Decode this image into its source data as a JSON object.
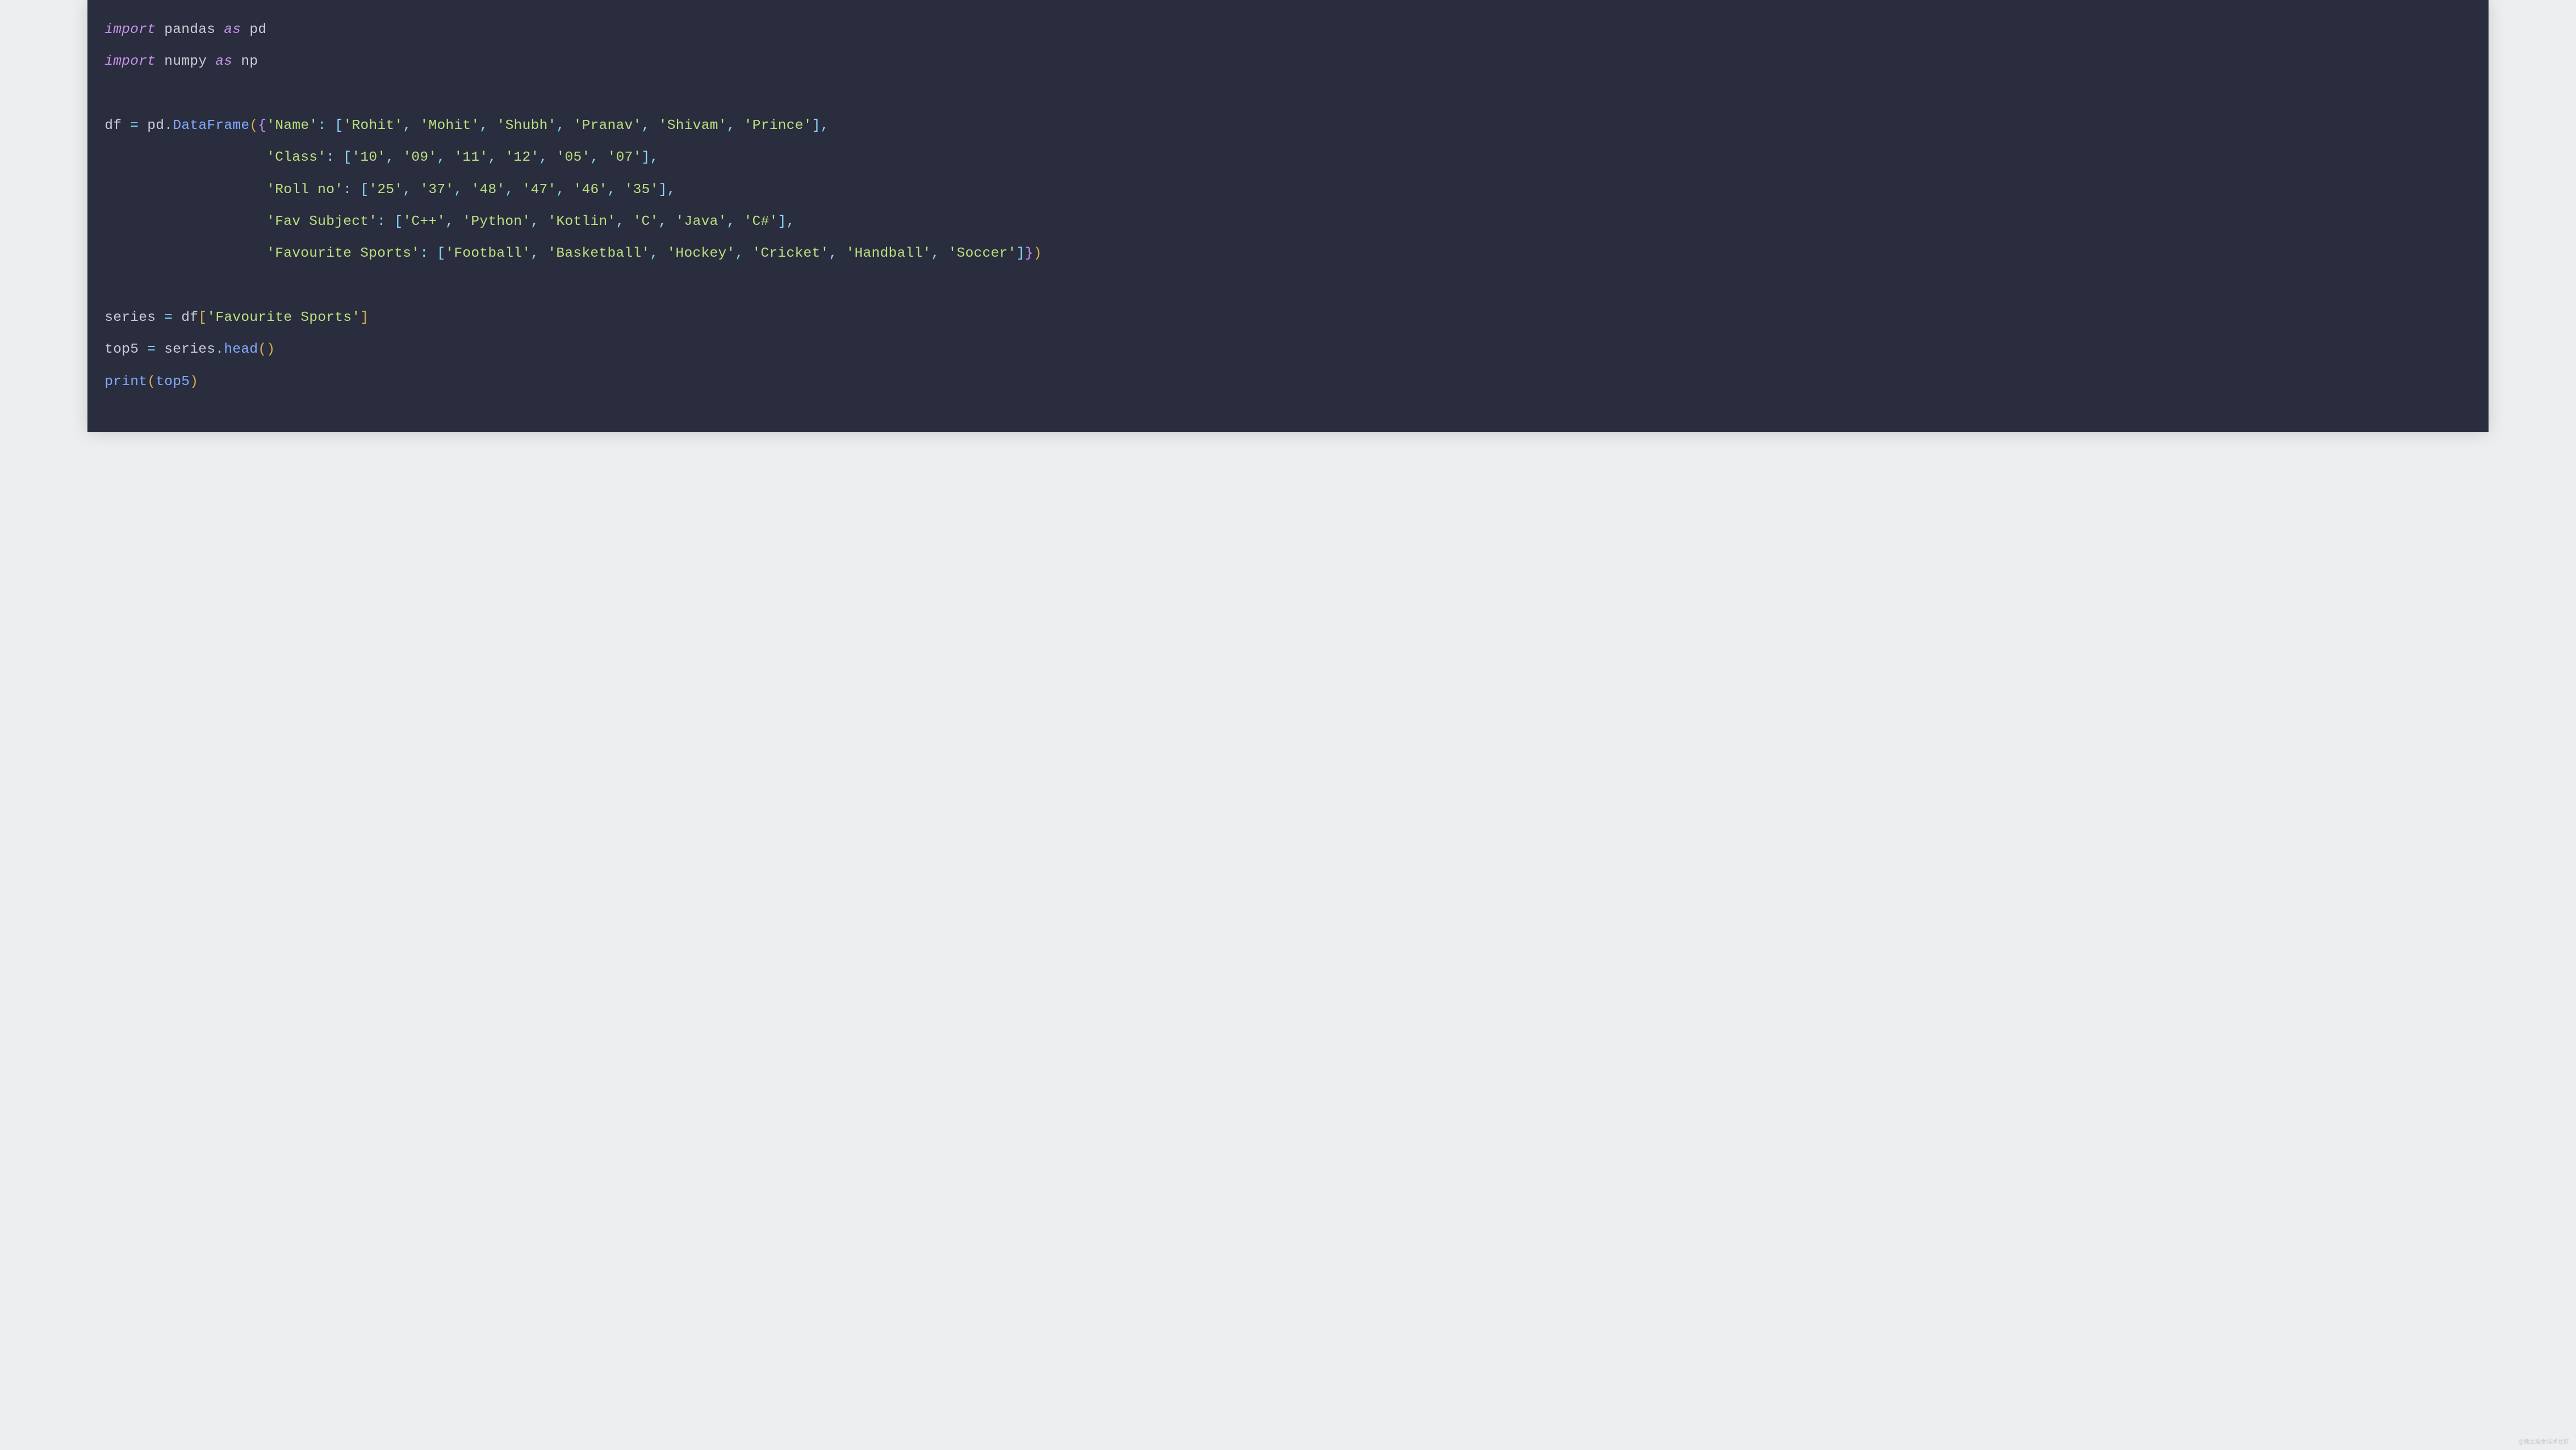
{
  "code": {
    "line1": {
      "import": "import",
      "module": "pandas",
      "as": "as",
      "alias": "pd"
    },
    "line2": {
      "import": "import",
      "module": "numpy",
      "as": "as",
      "alias": "np"
    },
    "line3": {
      "var": "df",
      "eq": "=",
      "pd": "pd",
      "dot": ".",
      "cls": "DataFrame",
      "lparen": "(",
      "lbrace": "{",
      "key1": "'Name'",
      "colon": ":",
      "lbr": "[",
      "v1": "'Rohit'",
      "v2": "'Mohit'",
      "v3": "'Shubh'",
      "v4": "'Pranav'",
      "v5": "'Shivam'",
      "v6": "'Prince'",
      "rbr": "]",
      "comma": ","
    },
    "line4": {
      "key": "'Class'",
      "colon": ":",
      "lbr": "[",
      "v1": "'10'",
      "v2": "'09'",
      "v3": "'11'",
      "v4": "'12'",
      "v5": "'05'",
      "v6": "'07'",
      "rbr": "]",
      "comma": ","
    },
    "line5": {
      "key": "'Roll no'",
      "colon": ":",
      "lbr": "[",
      "v1": "'25'",
      "v2": "'37'",
      "v3": "'48'",
      "v4": "'47'",
      "v5": "'46'",
      "v6": "'35'",
      "rbr": "]",
      "comma": ","
    },
    "line6": {
      "key": "'Fav Subject'",
      "colon": ":",
      "lbr": "[",
      "v1": "'C++'",
      "v2": "'Python'",
      "v3": "'Kotlin'",
      "v4": "'C'",
      "v5": "'Java'",
      "v6": "'C#'",
      "rbr": "]",
      "comma": ","
    },
    "line7": {
      "key": "'Favourite Sports'",
      "colon": ":",
      "lbr": "[",
      "v1": "'Football'",
      "v2": "'Basketball'",
      "v3": "'Hockey'",
      "v4": "'Cricket'",
      "v5": "'Handball'",
      "v6": "'Soccer'",
      "rbr": "]",
      "rbrace": "}",
      "rparen": ")",
      "comma": ","
    },
    "line8": {
      "var": "series",
      "eq": "=",
      "df": "df",
      "lbr": "[",
      "key": "'Favourite Sports'",
      "rbr": "]"
    },
    "line9": {
      "var": "top5",
      "eq": "=",
      "series": "series",
      "dot": ".",
      "head": "head",
      "lparen": "(",
      "rparen": ")"
    },
    "line10": {
      "print": "print",
      "lparen": "(",
      "arg": "top5",
      "rparen": ")"
    }
  },
  "watermark": "@稀土掘金技术社区"
}
